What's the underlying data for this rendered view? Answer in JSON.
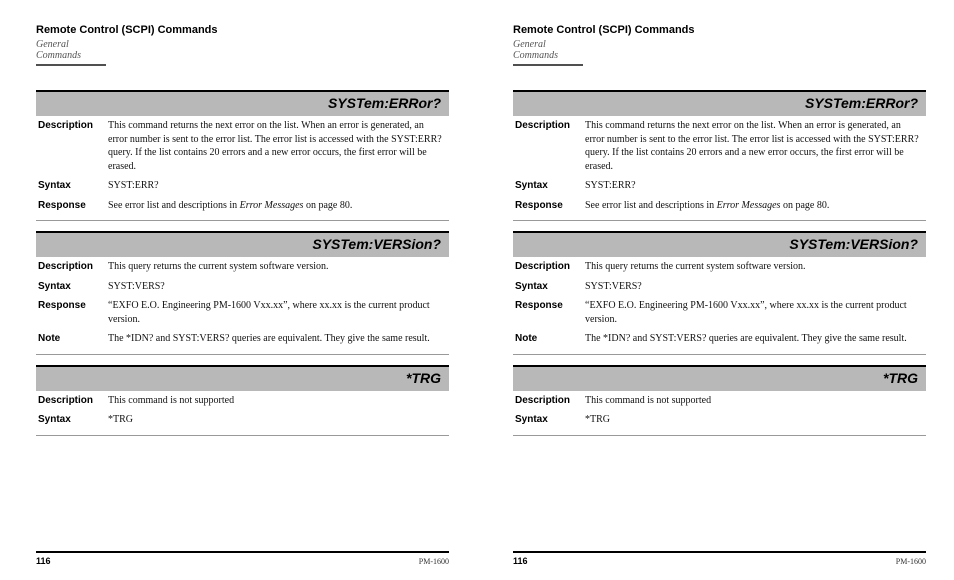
{
  "header": {
    "title": "Remote Control (SCPI) Commands",
    "subtitle": "General Commands"
  },
  "blocks": [
    {
      "name": "SYSTem:ERRor?",
      "rows": [
        {
          "label": "Description",
          "text": "This command returns the next error on the list. When an error is generated, an error number is sent to the error list. The error list is accessed with the SYST:ERR? query. If the list contains 20 errors and a new error occurs, the first error will be erased."
        },
        {
          "label": "Syntax",
          "text": "SYST:ERR?"
        },
        {
          "label": "Response",
          "text_pre": "See error list and descriptions in ",
          "text_em": "Error Messages",
          "text_post": " on page 80."
        }
      ]
    },
    {
      "name": "SYSTem:VERSion?",
      "rows": [
        {
          "label": "Description",
          "text": "This query returns the current system software version."
        },
        {
          "label": "Syntax",
          "text": "SYST:VERS?"
        },
        {
          "label": "Response",
          "text": "“EXFO E.O. Engineering PM-1600 Vxx.xx”, where xx.xx is the current product version."
        },
        {
          "label": "Note",
          "text": "The *IDN? and SYST:VERS? queries are equivalent. They give the same result."
        }
      ]
    },
    {
      "name": "*TRG",
      "rows": [
        {
          "label": "Description",
          "text": "This command is not supported"
        },
        {
          "label": "Syntax",
          "text": "*TRG"
        }
      ]
    }
  ],
  "footer": {
    "page": "116",
    "model": "PM-1600"
  }
}
